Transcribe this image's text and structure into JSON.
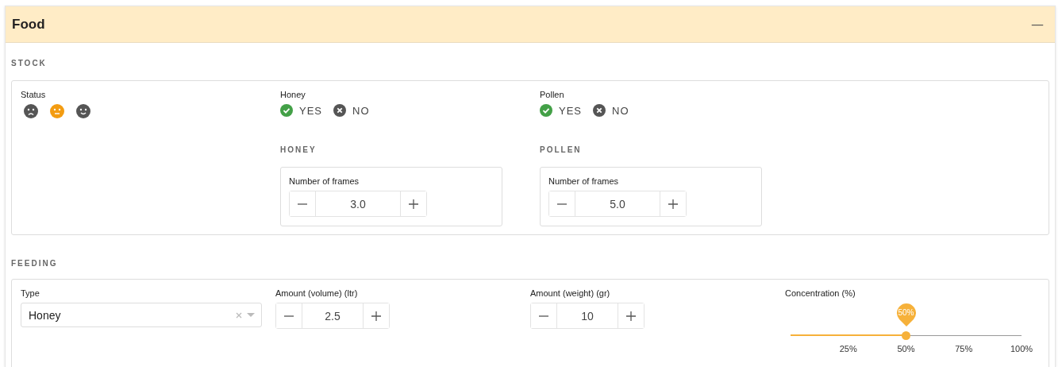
{
  "panel": {
    "title": "Food",
    "collapse_icon": "—"
  },
  "stock": {
    "heading": "STOCK",
    "status": {
      "label": "Status",
      "options": [
        {
          "kind": "sad",
          "selected": false
        },
        {
          "kind": "neutral",
          "selected": true
        },
        {
          "kind": "happy",
          "selected": false
        }
      ]
    },
    "toggles": [
      {
        "label": "Honey",
        "options": [
          {
            "kind": "yes",
            "label": "YES",
            "selected": true
          },
          {
            "kind": "no",
            "label": "NO",
            "selected": false
          }
        ]
      },
      {
        "label": "Pollen",
        "options": [
          {
            "kind": "yes",
            "label": "YES",
            "selected": true
          },
          {
            "kind": "no",
            "label": "NO",
            "selected": false
          }
        ]
      }
    ],
    "frames": [
      {
        "heading": "HONEY",
        "label": "Number of frames",
        "value": "3.0"
      },
      {
        "heading": "POLLEN",
        "label": "Number of frames",
        "value": "5.0"
      }
    ]
  },
  "feeding": {
    "heading": "FEEDING",
    "type": {
      "label": "Type",
      "value": "Honey"
    },
    "amounts": [
      {
        "label": "Amount (volume) (ltr)",
        "value": "2.5"
      },
      {
        "label": "Amount (weight) (gr)",
        "value": "10"
      }
    ],
    "concentration": {
      "label": "Concentration (%)",
      "level": 0.5,
      "reading": "50%",
      "ticks": [
        "25%",
        "50%",
        "75%",
        "100%"
      ]
    }
  }
}
